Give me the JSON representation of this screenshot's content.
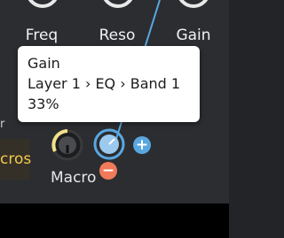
{
  "knobs_top": [
    {
      "label": "Freq"
    },
    {
      "label": "Reso"
    },
    {
      "label": "Gain"
    }
  ],
  "left_strip": {
    "partial_text": "cros",
    "partial_tick": "r"
  },
  "tooltip": {
    "param_name": "Gain",
    "path": "Layer 1 › EQ › Band 1",
    "value": "33%"
  },
  "macro": {
    "label": "Macro",
    "add_symbol": "+",
    "remove_symbol": "−"
  },
  "colors": {
    "accent_blue": "#5aa7e0",
    "accent_orange": "#f07a5a",
    "knob_yellow": "#f2e08a"
  }
}
